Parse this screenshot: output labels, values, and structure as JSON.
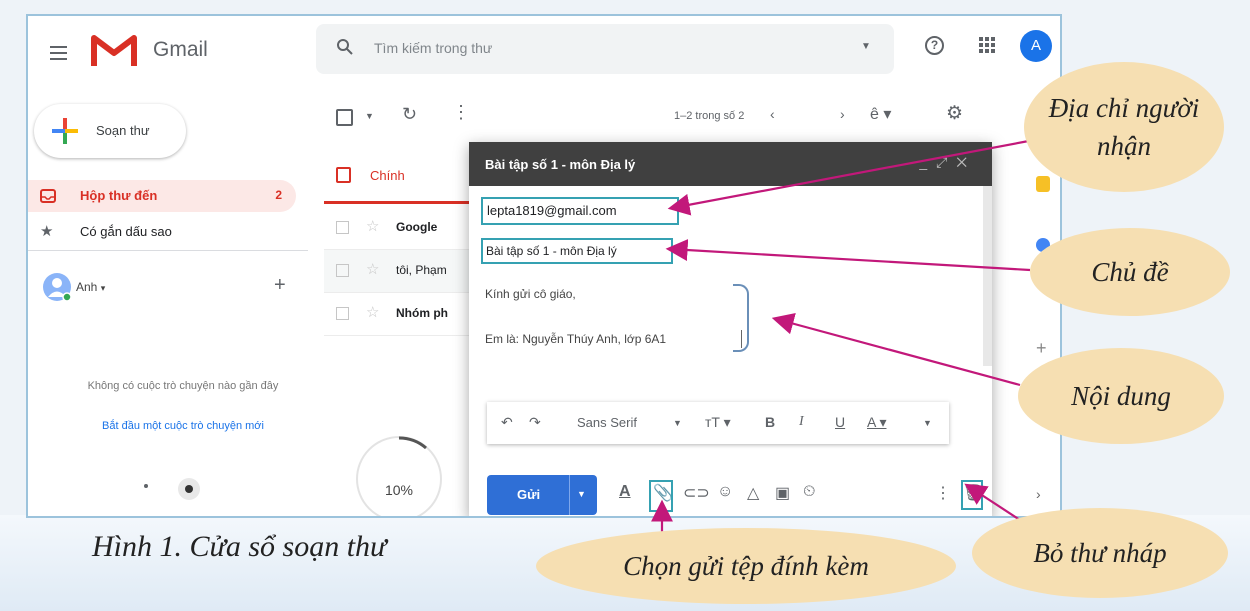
{
  "header": {
    "app_name": "Gmail",
    "search_placeholder": "Tìm kiếm trong thư",
    "avatar_initial": "A"
  },
  "sidebar": {
    "compose_label": "Soạn thư",
    "items": [
      {
        "label": "Hộp thư đến",
        "count": "2"
      },
      {
        "label": "Có gắn dấu sao",
        "count": ""
      }
    ],
    "chat_user": "Anh",
    "chat_empty": "Không có cuộc trò chuyện nào gần đây",
    "chat_start_link": "Bắt đầu một cuộc trò chuyện mới",
    "progress": "10%"
  },
  "toolbar": {
    "range_text": "1–2 trong số 2"
  },
  "mail_list": {
    "tab_label": "Chính",
    "rows": [
      {
        "sender": "Google"
      },
      {
        "sender": "tôi, Phạm"
      },
      {
        "sender": "Nhóm ph"
      }
    ]
  },
  "compose": {
    "title": "Bài tập số 1 - môn Địa lý",
    "to": "lepta1819@gmail.com",
    "subject": "Bài tập số 1 - môn Địa lý",
    "body_line1": "Kính gửi cô giáo,",
    "body_line2": "Em là: Nguyễn Thúy Anh, lớp 6A1",
    "font_name": "Sans Serif",
    "send_label": "Gửi"
  },
  "annotations": {
    "recipient": "Địa chỉ người nhận",
    "subject": "Chủ đề",
    "content": "Nội dung",
    "attach": "Chọn gửi tệp đính kèm",
    "discard": "Bỏ thư nháp",
    "caption": "Hình 1. Cửa sổ soạn thư"
  },
  "colors": {
    "gmail_red": "#d93025",
    "send_blue": "#2f6fd6",
    "highlight_box": "#35a1b2",
    "arrow": "#c2187a",
    "bubble": "#f6dfb2"
  }
}
